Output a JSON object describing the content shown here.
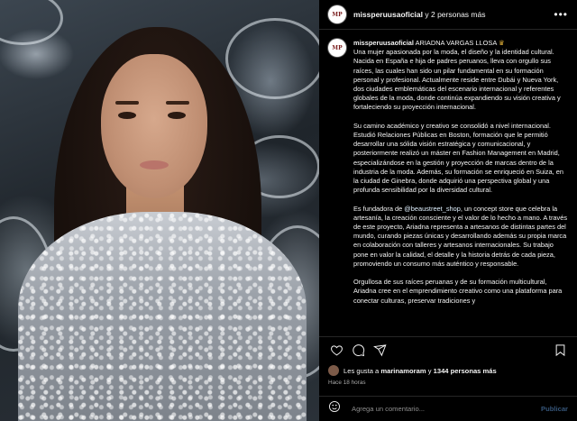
{
  "header": {
    "avatar_text": "MISS PERÚ",
    "account": "missperuusaoficial",
    "collab_suffix": " y 2 personas más",
    "more_icon": "more-horizontal-icon"
  },
  "caption": {
    "username": "missperuusaoficial",
    "title": "ARIADNA VARGAS LLOSA",
    "title_icon": "crown-icon",
    "p1": "Una mujer apasionada por la moda, el diseño y la identidad cultural. Nacida en España e hija de padres peruanos, lleva con orgullo sus raíces, las cuales han sido un pilar fundamental en su formación personal y profesional. Actualmente reside entre Dubái y Nueva York, dos ciudades emblemáticas del escenario internacional y referentes globales de la moda, donde continúa expandiendo su visión creativa y fortaleciendo su proyección internacional.",
    "p2": "Su camino académico y creativo se consolidó a nivel internacional. Estudió Relaciones Públicas en Boston, formación que le permitió desarrollar una sólida visión estratégica y comunicacional, y posteriormente realizó un máster en Fashion Management en Madrid, especializándose en la gestión y proyección de marcas dentro de la industria de la moda. Además, su formación se enriqueció en Suiza, en la ciudad de Ginebra, donde adquirió una perspectiva global y una profunda sensibilidad por la diversidad cultural.",
    "p3_pre": "Es fundadora de ",
    "p3_mention": "@beaustreet_shop",
    "p3_post": ", un concept store que celebra la artesanía, la creación consciente y el valor de lo hecho a mano. A través de este proyecto, Ariadna representa a artesanos de distintas partes del mundo, curando piezas únicas y desarrollando además su propia marca en colaboración con talleres y artesanos internacionales. Su trabajo pone en valor la calidad, el detalle y la historia detrás de cada pieza, promoviendo un consumo más auténtico y responsable.",
    "p4": "Orgullosa de sus raíces peruanas y de su formación multicultural, Ariadna cree en el emprendimiento creativo como una plataforma para conectar culturas, preservar tradiciones y"
  },
  "actions": {
    "like_icon": "heart-icon",
    "comment_icon": "comment-icon",
    "share_icon": "share-icon",
    "save_icon": "bookmark-icon"
  },
  "likes": {
    "prefix": "Les gusta a ",
    "user": "marinamoram",
    "middle": " y ",
    "count": "1344 personas más"
  },
  "timestamp": "Hace 18 horas",
  "comment": {
    "emoji_icon": "emoji-icon",
    "placeholder": "Agrega un comentario...",
    "post_label": "Publicar"
  },
  "colors": {
    "background": "#000000",
    "text": "#f5f5f5",
    "muted": "#a8a8a8",
    "link": "#e0f1ff",
    "post_disabled": "#36567a"
  }
}
